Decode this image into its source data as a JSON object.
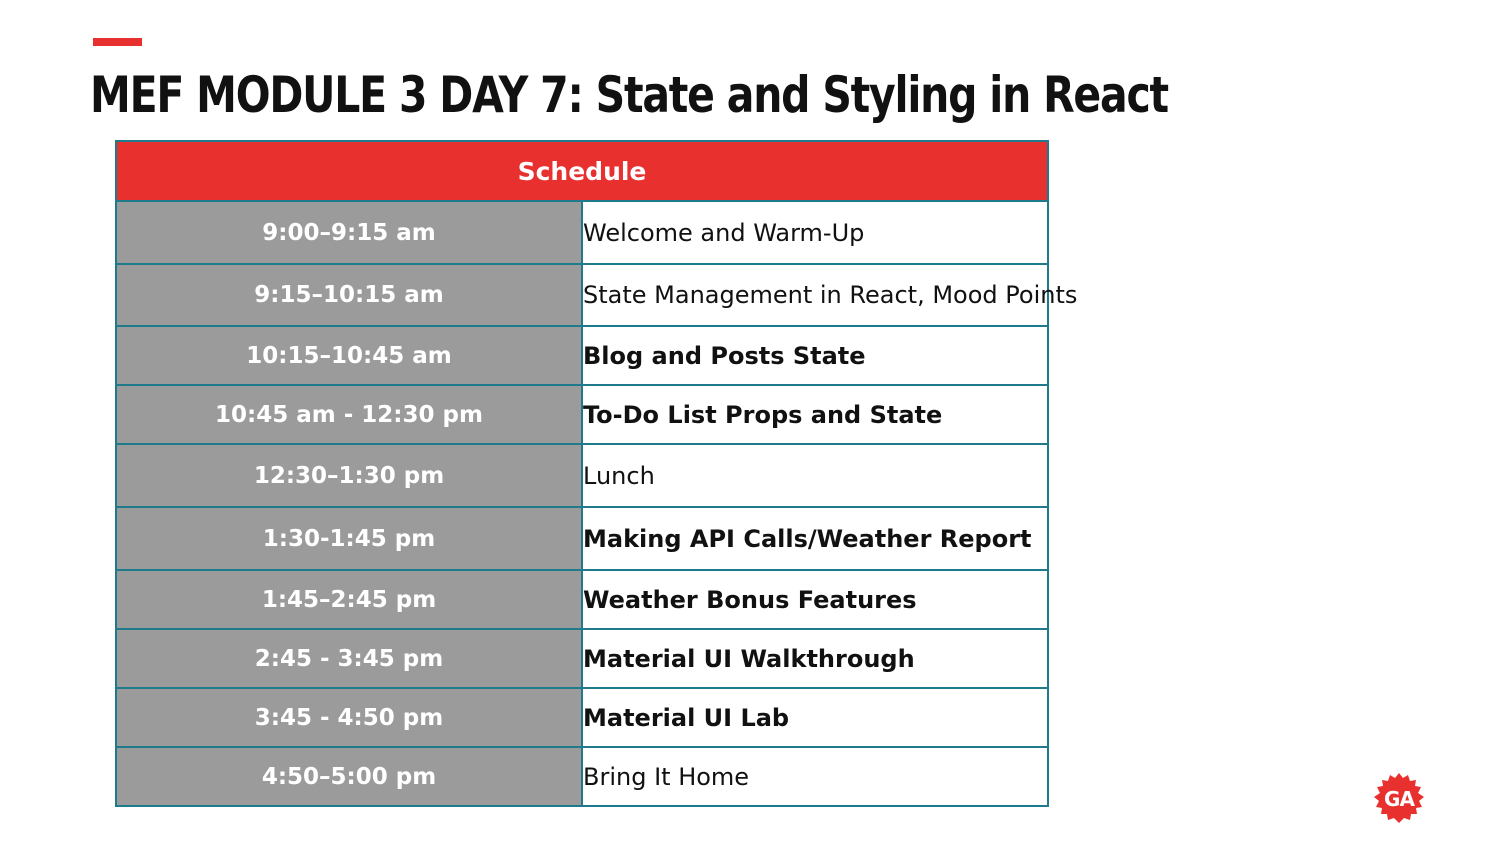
{
  "slide": {
    "title": "MEF MODULE 3 DAY 7: State and Styling in React"
  },
  "schedule": {
    "header": "Schedule",
    "rows": [
      {
        "time": "9:00–9:15 am",
        "activity": "Welcome and Warm-Up",
        "bold": false
      },
      {
        "time": "9:15–10:15 am",
        "activity": "State Management in React, Mood Points",
        "bold": false
      },
      {
        "time": "10:15–10:45 am",
        "activity": "Blog and Posts State",
        "bold": true
      },
      {
        "time": "10:45 am - 12:30 pm",
        "activity": "To-Do List Props and State",
        "bold": true
      },
      {
        "time": "12:30–1:30 pm",
        "activity": "Lunch",
        "bold": false
      },
      {
        "time": "1:30-1:45 pm",
        "activity": "Making API Calls/Weather Report",
        "bold": true
      },
      {
        "time": "1:45–2:45 pm",
        "activity": "Weather Bonus Features",
        "bold": true
      },
      {
        "time": "2:45 - 3:45 pm",
        "activity": "Material UI Walkthrough",
        "bold": true
      },
      {
        "time": "3:45 - 4:50 pm",
        "activity": "Material UI Lab",
        "bold": true
      },
      {
        "time": "4:50–5:00 pm",
        "activity": "Bring It Home",
        "bold": false
      }
    ]
  },
  "logo": {
    "text": "GA",
    "icon": "ga-logo-icon",
    "color": "#e8302f"
  },
  "colors": {
    "accent": "#e8302f",
    "time_cell": "#9b9b9b",
    "border": "#1f7a8c"
  }
}
